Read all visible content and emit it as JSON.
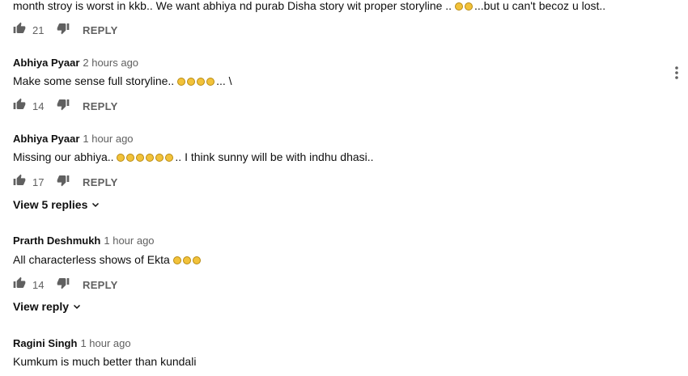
{
  "top_comment": {
    "text_before": "month stroy is worst in kkb.. We want abhiya nd purab Disha story wit proper storyline .. ",
    "emoji": [
      "😍",
      "😍"
    ],
    "text_after": "...but u can't becoz u lost..",
    "likes": "21",
    "reply_label": "REPLY"
  },
  "comments": [
    {
      "author": "Abhiya Pyaar",
      "time": "2 hours ago",
      "text_before": "Make some sense full storyline.. ",
      "emoji": [
        "😑",
        "😑",
        "😑",
        "😑"
      ],
      "text_after": "... \\",
      "likes": "14",
      "reply_label": "REPLY"
    },
    {
      "author": "Abhiya Pyaar",
      "time": "1 hour ago",
      "text_before": "Missing our abhiya.. ",
      "emoji": [
        "😍",
        "😍",
        "😍",
        "😵",
        "😵",
        "😵"
      ],
      "text_after": ".. I think sunny will be with indhu dhasi..",
      "likes": "17",
      "reply_label": "REPLY",
      "view_replies": "View 5 replies"
    },
    {
      "author": "Prarth Deshmukh",
      "time": "1 hour ago",
      "text_before": "All characterless shows of Ekta ",
      "emoji": [
        "😭",
        "😭",
        "😭"
      ],
      "text_after": "",
      "likes": "14",
      "reply_label": "REPLY",
      "view_replies": "View reply"
    },
    {
      "author": "Ragini Singh",
      "time": "1 hour ago",
      "text_before": "Kumkum is much better than kundali",
      "emoji": [],
      "text_after": ""
    }
  ],
  "icons": {
    "like": "thumb-up-icon",
    "dislike": "thumb-down-icon",
    "more": "more-vert-icon",
    "chevron": "chevron-down-icon"
  }
}
